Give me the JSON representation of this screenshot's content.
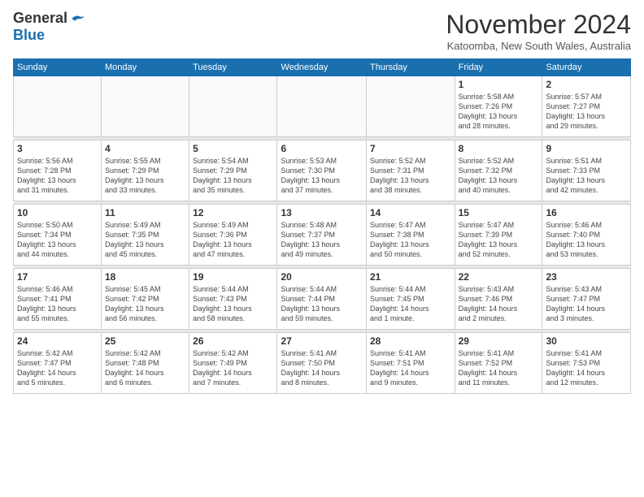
{
  "logo": {
    "general": "General",
    "blue": "Blue"
  },
  "header": {
    "month": "November 2024",
    "location": "Katoomba, New South Wales, Australia"
  },
  "weekdays": [
    "Sunday",
    "Monday",
    "Tuesday",
    "Wednesday",
    "Thursday",
    "Friday",
    "Saturday"
  ],
  "weeks": [
    [
      {
        "day": "",
        "info": ""
      },
      {
        "day": "",
        "info": ""
      },
      {
        "day": "",
        "info": ""
      },
      {
        "day": "",
        "info": ""
      },
      {
        "day": "",
        "info": ""
      },
      {
        "day": "1",
        "info": "Sunrise: 5:58 AM\nSunset: 7:26 PM\nDaylight: 13 hours\nand 28 minutes."
      },
      {
        "day": "2",
        "info": "Sunrise: 5:57 AM\nSunset: 7:27 PM\nDaylight: 13 hours\nand 29 minutes."
      }
    ],
    [
      {
        "day": "3",
        "info": "Sunrise: 5:56 AM\nSunset: 7:28 PM\nDaylight: 13 hours\nand 31 minutes."
      },
      {
        "day": "4",
        "info": "Sunrise: 5:55 AM\nSunset: 7:29 PM\nDaylight: 13 hours\nand 33 minutes."
      },
      {
        "day": "5",
        "info": "Sunrise: 5:54 AM\nSunset: 7:29 PM\nDaylight: 13 hours\nand 35 minutes."
      },
      {
        "day": "6",
        "info": "Sunrise: 5:53 AM\nSunset: 7:30 PM\nDaylight: 13 hours\nand 37 minutes."
      },
      {
        "day": "7",
        "info": "Sunrise: 5:52 AM\nSunset: 7:31 PM\nDaylight: 13 hours\nand 38 minutes."
      },
      {
        "day": "8",
        "info": "Sunrise: 5:52 AM\nSunset: 7:32 PM\nDaylight: 13 hours\nand 40 minutes."
      },
      {
        "day": "9",
        "info": "Sunrise: 5:51 AM\nSunset: 7:33 PM\nDaylight: 13 hours\nand 42 minutes."
      }
    ],
    [
      {
        "day": "10",
        "info": "Sunrise: 5:50 AM\nSunset: 7:34 PM\nDaylight: 13 hours\nand 44 minutes."
      },
      {
        "day": "11",
        "info": "Sunrise: 5:49 AM\nSunset: 7:35 PM\nDaylight: 13 hours\nand 45 minutes."
      },
      {
        "day": "12",
        "info": "Sunrise: 5:49 AM\nSunset: 7:36 PM\nDaylight: 13 hours\nand 47 minutes."
      },
      {
        "day": "13",
        "info": "Sunrise: 5:48 AM\nSunset: 7:37 PM\nDaylight: 13 hours\nand 49 minutes."
      },
      {
        "day": "14",
        "info": "Sunrise: 5:47 AM\nSunset: 7:38 PM\nDaylight: 13 hours\nand 50 minutes."
      },
      {
        "day": "15",
        "info": "Sunrise: 5:47 AM\nSunset: 7:39 PM\nDaylight: 13 hours\nand 52 minutes."
      },
      {
        "day": "16",
        "info": "Sunrise: 5:46 AM\nSunset: 7:40 PM\nDaylight: 13 hours\nand 53 minutes."
      }
    ],
    [
      {
        "day": "17",
        "info": "Sunrise: 5:46 AM\nSunset: 7:41 PM\nDaylight: 13 hours\nand 55 minutes."
      },
      {
        "day": "18",
        "info": "Sunrise: 5:45 AM\nSunset: 7:42 PM\nDaylight: 13 hours\nand 56 minutes."
      },
      {
        "day": "19",
        "info": "Sunrise: 5:44 AM\nSunset: 7:43 PM\nDaylight: 13 hours\nand 58 minutes."
      },
      {
        "day": "20",
        "info": "Sunrise: 5:44 AM\nSunset: 7:44 PM\nDaylight: 13 hours\nand 59 minutes."
      },
      {
        "day": "21",
        "info": "Sunrise: 5:44 AM\nSunset: 7:45 PM\nDaylight: 14 hours\nand 1 minute."
      },
      {
        "day": "22",
        "info": "Sunrise: 5:43 AM\nSunset: 7:46 PM\nDaylight: 14 hours\nand 2 minutes."
      },
      {
        "day": "23",
        "info": "Sunrise: 5:43 AM\nSunset: 7:47 PM\nDaylight: 14 hours\nand 3 minutes."
      }
    ],
    [
      {
        "day": "24",
        "info": "Sunrise: 5:42 AM\nSunset: 7:47 PM\nDaylight: 14 hours\nand 5 minutes."
      },
      {
        "day": "25",
        "info": "Sunrise: 5:42 AM\nSunset: 7:48 PM\nDaylight: 14 hours\nand 6 minutes."
      },
      {
        "day": "26",
        "info": "Sunrise: 5:42 AM\nSunset: 7:49 PM\nDaylight: 14 hours\nand 7 minutes."
      },
      {
        "day": "27",
        "info": "Sunrise: 5:41 AM\nSunset: 7:50 PM\nDaylight: 14 hours\nand 8 minutes."
      },
      {
        "day": "28",
        "info": "Sunrise: 5:41 AM\nSunset: 7:51 PM\nDaylight: 14 hours\nand 9 minutes."
      },
      {
        "day": "29",
        "info": "Sunrise: 5:41 AM\nSunset: 7:52 PM\nDaylight: 14 hours\nand 11 minutes."
      },
      {
        "day": "30",
        "info": "Sunrise: 5:41 AM\nSunset: 7:53 PM\nDaylight: 14 hours\nand 12 minutes."
      }
    ]
  ]
}
